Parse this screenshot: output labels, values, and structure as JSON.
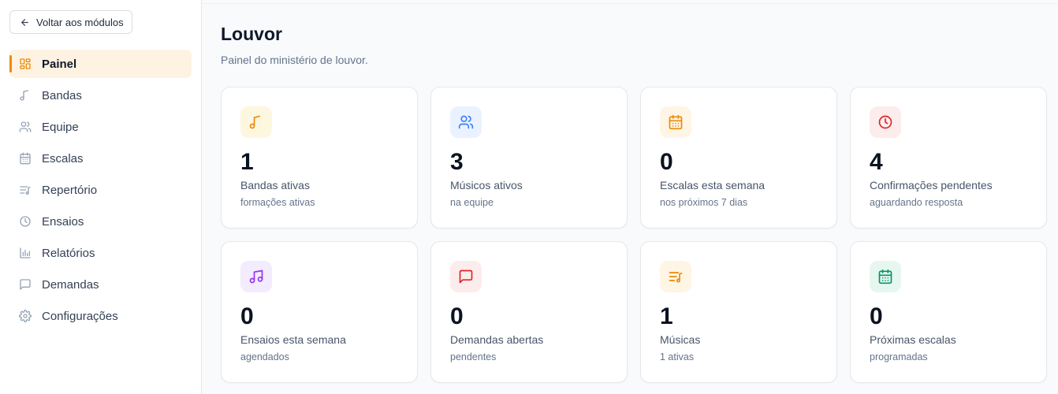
{
  "sidebar": {
    "back_label": "Voltar aos módulos",
    "items": [
      {
        "label": "Painel",
        "icon": "layout-grid-icon",
        "active": true
      },
      {
        "label": "Bandas",
        "icon": "music-note-icon"
      },
      {
        "label": "Equipe",
        "icon": "users-icon"
      },
      {
        "label": "Escalas",
        "icon": "calendar-icon"
      },
      {
        "label": "Repertório",
        "icon": "music-list-icon"
      },
      {
        "label": "Ensaios",
        "icon": "clock-icon"
      },
      {
        "label": "Relatórios",
        "icon": "bar-chart-icon"
      },
      {
        "label": "Demandas",
        "icon": "message-square-icon"
      },
      {
        "label": "Configurações",
        "icon": "gear-icon"
      }
    ]
  },
  "header": {
    "title": "Louvor",
    "subtitle": "Painel do ministério de louvor."
  },
  "stats": [
    {
      "value": "1",
      "label": "Bandas ativas",
      "sub": "formações ativas",
      "icon": "music-note-icon",
      "color": "#ea8a0a",
      "bg": "#fef7e0"
    },
    {
      "value": "3",
      "label": "Músicos ativos",
      "sub": "na equipe",
      "icon": "users-icon",
      "color": "#3b82f6",
      "bg": "#eaf2ff"
    },
    {
      "value": "0",
      "label": "Escalas esta semana",
      "sub": "nos próximos 7 dias",
      "icon": "calendar-icon",
      "color": "#ea8a0a",
      "bg": "#fef5e4"
    },
    {
      "value": "4",
      "label": "Confirmações pendentes",
      "sub": "aguardando resposta",
      "icon": "clock-icon",
      "color": "#dc2626",
      "bg": "#fdecec"
    },
    {
      "value": "0",
      "label": "Ensaios esta semana",
      "sub": "agendados",
      "icon": "music-notes-icon",
      "color": "#9333ea",
      "bg": "#f3ebfe"
    },
    {
      "value": "0",
      "label": "Demandas abertas",
      "sub": "pendentes",
      "icon": "message-square-icon",
      "color": "#dc2626",
      "bg": "#fdecec"
    },
    {
      "value": "1",
      "label": "Músicas",
      "sub": "1 ativas",
      "icon": "music-list-icon",
      "color": "#ea8a0a",
      "bg": "#fef5e4"
    },
    {
      "value": "0",
      "label": "Próximas escalas",
      "sub": "programadas",
      "icon": "calendar-days-icon",
      "color": "#059669",
      "bg": "#e6f7ef"
    }
  ]
}
